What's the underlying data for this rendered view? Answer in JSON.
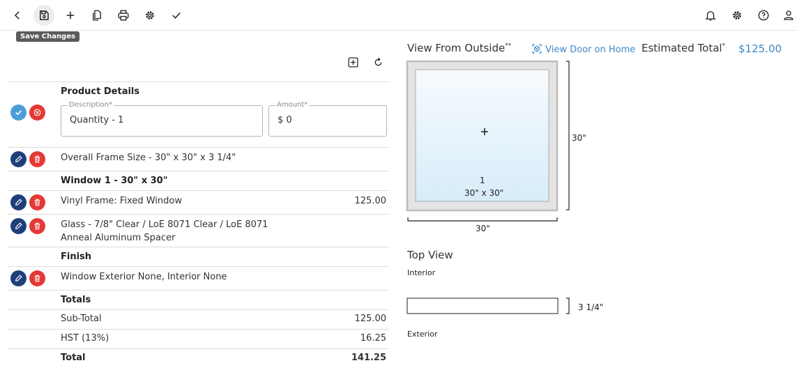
{
  "toolbar": {
    "tooltip": "Save Changes",
    "left_icons": [
      "back-icon",
      "save-icon",
      "add-icon",
      "copy-icon",
      "print-icon",
      "settings-icon",
      "check-icon"
    ],
    "right_icons": [
      "bell-icon",
      "gear-icon",
      "help-icon",
      "user-icon"
    ]
  },
  "product": {
    "header": "Product Details",
    "description_label": "Description*",
    "description_value": "Quantity - 1",
    "amount_label": "Amount*",
    "amount_value": "$ 0",
    "items": [
      {
        "text": "Overall Frame Size - 30\" x 30\" x 3 1/4\"",
        "amount": ""
      },
      {
        "text": "Window 1 - 30\" x 30\"",
        "amount": ""
      },
      {
        "text": "Vinyl Frame: Fixed Window",
        "amount": "125.00"
      },
      {
        "text_line1": "Glass - 7/8\" Clear / LoE 8071 Clear / LoE 8071",
        "text_line2": "Anneal Aluminum Spacer",
        "amount": ""
      },
      {
        "text": "Finish",
        "amount": ""
      },
      {
        "text": "Window Exterior None, Interior None",
        "amount": ""
      }
    ],
    "totals_header": "Totals",
    "subtotal_label": "Sub-Total",
    "subtotal_value": "125.00",
    "hst_label": "HST (13%)",
    "hst_value": "16.25",
    "total_label": "Total",
    "total_value": "141.25"
  },
  "view": {
    "title": "View From Outside",
    "title_sup": "**",
    "link": "View Door on Home",
    "estimated_label": "Estimated Total",
    "estimated_sup": "*",
    "estimated_value": "$125.00",
    "pane_number": "1",
    "pane_size": "30\" x 30\"",
    "height_dim": "30\"",
    "width_dim": "30\""
  },
  "top_view": {
    "title": "Top View",
    "interior": "Interior",
    "exterior": "Exterior",
    "depth_dim": "3 1/4\""
  },
  "colors": {
    "accent": "#3f88c5",
    "edit": "#1f3f7a",
    "delete": "#e53935",
    "confirm": "#4a9fd8"
  }
}
